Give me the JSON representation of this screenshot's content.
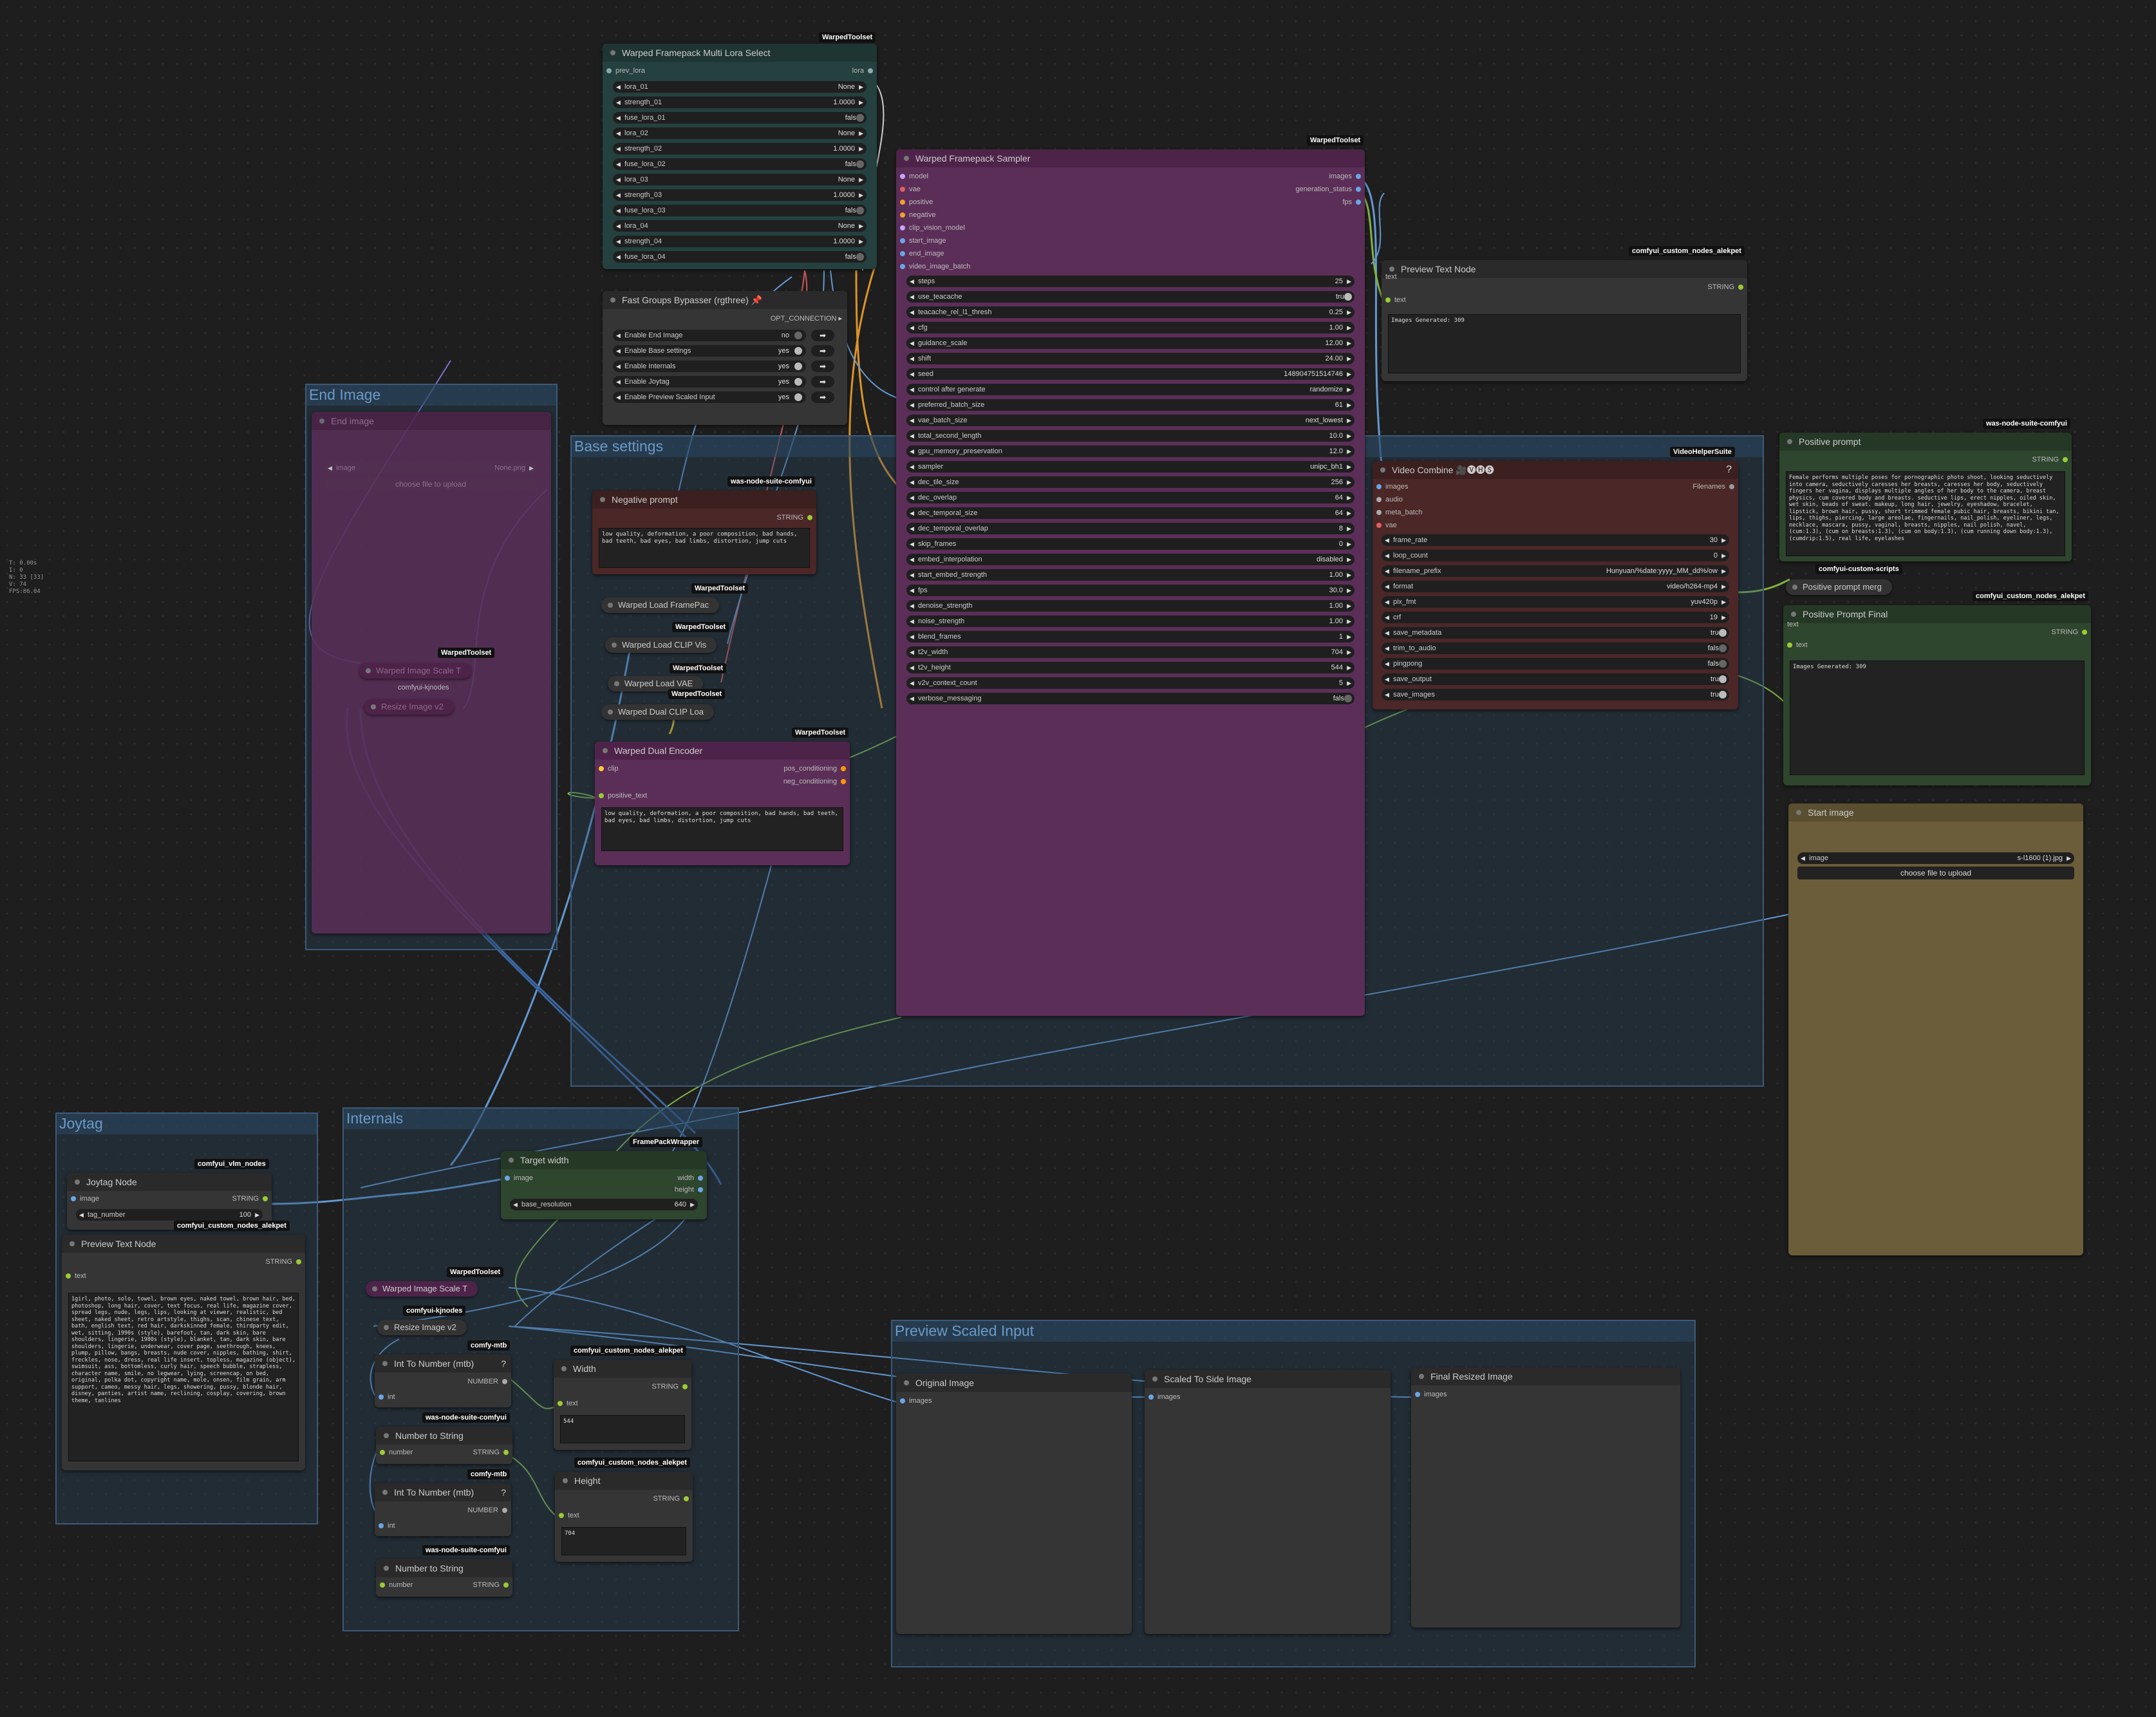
{
  "stats": {
    "lines": [
      "T: 0.00s",
      "I: 0",
      "N: 33 [33]",
      "V: 74",
      "FPS:86.04"
    ]
  },
  "groups": {
    "end_image": "End Image",
    "base_settings": "Base settings",
    "joytag": "Joytag",
    "internals": "Internals",
    "preview_scaled_input": "Preview Scaled Input"
  },
  "lora_node": {
    "badge": "WarpedToolset",
    "title": "Warped Framepack Multi Lora Select",
    "input": "prev_lora",
    "output": "lora",
    "widgets": [
      {
        "label": "lora_01",
        "value": "None"
      },
      {
        "label": "strength_01",
        "value": "1.0000"
      },
      {
        "label": "fuse_lora_01",
        "value": "false"
      },
      {
        "label": "lora_02",
        "value": "None"
      },
      {
        "label": "strength_02",
        "value": "1.0000"
      },
      {
        "label": "fuse_lora_02",
        "value": "false"
      },
      {
        "label": "lora_03",
        "value": "None"
      },
      {
        "label": "strength_03",
        "value": "1.0000"
      },
      {
        "label": "fuse_lora_03",
        "value": "false"
      },
      {
        "label": "lora_04",
        "value": "None"
      },
      {
        "label": "strength_04",
        "value": "1.0000"
      },
      {
        "label": "fuse_lora_04",
        "value": "false"
      }
    ]
  },
  "bypasser": {
    "title": "Fast Groups Bypasser (rgthree)",
    "output": "OPT_CONNECTION",
    "rows": [
      {
        "label": "Enable End Image",
        "value": "no"
      },
      {
        "label": "Enable Base settings",
        "value": "yes"
      },
      {
        "label": "Enable Internals",
        "value": "yes"
      },
      {
        "label": "Enable Joytag",
        "value": "yes"
      },
      {
        "label": "Enable Preview Scaled Input",
        "value": "yes"
      }
    ]
  },
  "end_image_node": {
    "title": "End image",
    "widget_label": "image",
    "widget_value": "None.png",
    "upload": "choose file to upload"
  },
  "collapsed": {
    "scale_badge": "WarpedToolset",
    "warped_image_scale": "Warped Image Scale T",
    "comfyui_kjnodes": "comfyui-kjnodes",
    "resize_image": "Resize Image v2"
  },
  "negative_prompt": {
    "badge": "was-node-suite-comfyui",
    "title": "Negative prompt",
    "output": "STRING",
    "text": "low quality, deformation, a poor composition, bad hands, bad teeth, bad eyes, bad limbs, distortion, jump cuts"
  },
  "loaders": [
    {
      "badge": "WarpedToolset",
      "title": "Warped Load FramePac"
    },
    {
      "badge": "WarpedToolset",
      "title": "Warped Load CLIP Vis"
    },
    {
      "badge": "WarpedToolset",
      "title": "Warped Load VAE"
    },
    {
      "badge": "WarpedToolset",
      "title": "Warped Dual CLIP Loa"
    }
  ],
  "dual_encoder": {
    "badge": "WarpedToolset",
    "title": "Warped Dual Encoder",
    "input_clip": "clip",
    "input_text": "positive_text",
    "out1": "pos_conditioning",
    "out2": "neg_conditioning",
    "text": "low quality, deformation, a poor composition, bad hands, bad teeth, bad eyes, bad limbs, distortion, jump cuts"
  },
  "sampler": {
    "badge": "WarpedToolset",
    "title": "Warped Framepack Sampler",
    "inputs": [
      "model",
      "vae",
      "positive",
      "negative",
      "clip_vision_model",
      "start_image",
      "end_image",
      "video_image_batch"
    ],
    "outputs": [
      "images",
      "generation_status",
      "fps"
    ],
    "widgets": [
      {
        "label": "steps",
        "value": "25"
      },
      {
        "label": "use_teacache",
        "value": "true",
        "toggle": true
      },
      {
        "label": "teacache_rel_l1_thresh",
        "value": "0.25"
      },
      {
        "label": "cfg",
        "value": "1.00"
      },
      {
        "label": "guidance_scale",
        "value": "12.00"
      },
      {
        "label": "shift",
        "value": "24.00"
      },
      {
        "label": "seed",
        "value": "148904751514746"
      },
      {
        "label": "control after generate",
        "value": "randomize"
      },
      {
        "label": "preferred_batch_size",
        "value": "61"
      },
      {
        "label": "vae_batch_size",
        "value": "next_lowest"
      },
      {
        "label": "total_second_length",
        "value": "10.0"
      },
      {
        "label": "gpu_memory_preservation",
        "value": "12.0"
      },
      {
        "label": "sampler",
        "value": "unipc_bh1"
      },
      {
        "label": "dec_tile_size",
        "value": "256"
      },
      {
        "label": "dec_overlap",
        "value": "64"
      },
      {
        "label": "dec_temporal_size",
        "value": "64"
      },
      {
        "label": "dec_temporal_overlap",
        "value": "8"
      },
      {
        "label": "skip_frames",
        "value": "0"
      },
      {
        "label": "embed_interpolation",
        "value": "disabled"
      },
      {
        "label": "start_embed_strength",
        "value": "1.00"
      },
      {
        "label": "fps",
        "value": "30.0"
      },
      {
        "label": "denoise_strength",
        "value": "1.00"
      },
      {
        "label": "noise_strength",
        "value": "1.00"
      },
      {
        "label": "blend_frames",
        "value": "1"
      },
      {
        "label": "t2v_width",
        "value": "704"
      },
      {
        "label": "t2v_height",
        "value": "544"
      },
      {
        "label": "v2v_context_count",
        "value": "5"
      },
      {
        "label": "verbose_messaging",
        "value": "false",
        "toggle": true
      }
    ]
  },
  "preview_text_top": {
    "badge": "comfyui_custom_nodes_alekpet",
    "title": "Preview Text Node",
    "input": "text",
    "output": "STRING",
    "input2": "text",
    "text": "Images Generated: 309"
  },
  "video_combine": {
    "badge": "VideoHelperSuite",
    "title": "Video Combine 🎥🅥🅗🅢",
    "help": "?",
    "inputs": [
      "images",
      "audio",
      "meta_batch",
      "vae"
    ],
    "output": "Filenames",
    "widgets": [
      {
        "label": "frame_rate",
        "value": "30"
      },
      {
        "label": "loop_count",
        "value": "0"
      },
      {
        "label": "filename_prefix",
        "value": "Hunyuan/%date:yyyy_MM_dd%/ow"
      },
      {
        "label": "format",
        "value": "video/h264-mp4"
      },
      {
        "label": "pix_fmt",
        "value": "yuv420p"
      },
      {
        "label": "crf",
        "value": "19"
      },
      {
        "label": "save_metadata",
        "value": "true",
        "toggle": true
      },
      {
        "label": "trim_to_audio",
        "value": "false",
        "toggle": true
      },
      {
        "label": "pingpong",
        "value": "false",
        "toggle": true
      },
      {
        "label": "save_output",
        "value": "true",
        "toggle": true
      },
      {
        "label": "save_images",
        "value": "true",
        "toggle": true
      }
    ]
  },
  "positive_prompt": {
    "badge": "was-node-suite-comfyui",
    "title": "Positive prompt",
    "output": "STRING",
    "text": "Female performs multiple poses for pornographic photo shoot, looking seductively into camera, seductively caresses her breasts, caresses her body, seductively fingers her vagina, displays multiple angles of her body to the camera, breast physics, cum covered body and breasts. seductive lips, erect nipples, oiled skin, wet skin, beads of sweat. makeup, long hair, jewelry, eyeshadow, bracelet, lipstick, brown hair, pussy, short trimmed female pubic hair, breasts, bikini tan, lips, thighs, piercing, large areolae, fingernails, nail_polish, eyeliner, legs, necklace, mascara, pussy, vaginal, breasts, nipples, nail polish, navel, (cum:1.3), (cum on breasts:1.3), (cum on body:1.3), (cum running down body:1.3), (cumdrip:1.5), real life, eyelashes"
  },
  "merge": {
    "badge": "comfyui-custom-scripts",
    "title": "Positive prompt merg"
  },
  "positive_final": {
    "badge": "comfyui_custom_nodes_alekpet",
    "title": "Positive Prompt Final",
    "input": "text",
    "output": "STRING",
    "input2": "text",
    "text": "Images Generated: 309"
  },
  "start_image": {
    "title": "Start image",
    "widget_label": "image",
    "widget_value": "s-l1600 (1).jpg",
    "upload": "choose file to upload"
  },
  "joytag_node": {
    "badge": "comfyui_vlm_nodes",
    "title": "Joytag Node",
    "input": "image",
    "output": "STRING",
    "widget_label": "tag_number",
    "widget_value": "100"
  },
  "preview_text_joy": {
    "badge": "comfyui_custom_nodes_alekpet",
    "title": "Preview Text Node",
    "input": "text",
    "output": "STRING",
    "text": "1girl, photo, solo, towel, brown eyes, naked towel, brown hair, bed, photoshop, long hair, cover, text focus, real life, magazine cover, spread legs, nude, legs, lips, looking at viewer, realistic, bed sheet, naked sheet, retro artstyle, thighs, scan, chinese text, bath, english text, red hair, darkskinned female, thirdparty edit, wet, sitting, 1990s (style), barefoot, tan, dark skin, bare shoulders, lingerie, 1980s (style), blanket, tan, dark skin, bare shoulders, lingerie, underwear, cover page, seethrough, knees, plump, pillow, bangs, breasts, nude cover, nipples, bathing, shirt, freckles, nose, dress, real life insert, topless, magazine (object), swimsuit, ass, bottomless, curly hair, speech bubble, strapless, character name, smile, no legwear, lying, screencap, on bed, original, polka dot, copyright name, mole, onsen, film grain, arm support, cameo, messy hair, legs, showering, pussy, blonde hair, disney, panties, artist name, reclining, cosplay, covering, brown theme, tanlines"
  },
  "target_width": {
    "badge": "FramePackWrapper",
    "title": "Target width",
    "input": "image",
    "out1": "width",
    "out2": "height",
    "widget_label": "base_resolution",
    "widget_value": "640"
  },
  "int_nodes": [
    {
      "badge": "comfy-mtb",
      "title": "Int To Number (mtb)",
      "help": "?",
      "input": "int",
      "output": "NUMBER"
    },
    {
      "badge": "comfy-mtb",
      "title": "Int To Number (mtb)",
      "help": "?",
      "input": "int",
      "output": "NUMBER"
    }
  ],
  "num_to_str": [
    {
      "badge": "was-node-suite-comfyui",
      "title": "Number to String",
      "input": "number",
      "output": "STRING"
    },
    {
      "badge": "was-node-suite-comfyui",
      "title": "Number to String",
      "input": "number",
      "output": "STRING"
    }
  ],
  "width_node": {
    "badge": "comfyui_custom_nodes_alekpet",
    "title": "Width",
    "input": "text",
    "output": "STRING",
    "value": "544"
  },
  "height_node": {
    "badge": "comfyui_custom_nodes_alekpet",
    "title": "Height",
    "input": "text",
    "output": "STRING",
    "value": "704"
  },
  "preview_images": [
    {
      "title": "Original Image",
      "input": "images"
    },
    {
      "title": "Scaled To Side Image",
      "input": "images"
    },
    {
      "title": "Final Resized Image",
      "input": "images"
    }
  ],
  "colors": {
    "lora_node_bg": "#24403f",
    "purple": "#5b2e58",
    "maroon": "#4b2727",
    "green_node": "#2e452e",
    "olive": "#6b5d3a",
    "group": "#2c4862",
    "link_blue": "#6aa6e6",
    "link_orange": "#f0a12a",
    "link_green": "#8bc34a",
    "link_red": "#e06060"
  }
}
